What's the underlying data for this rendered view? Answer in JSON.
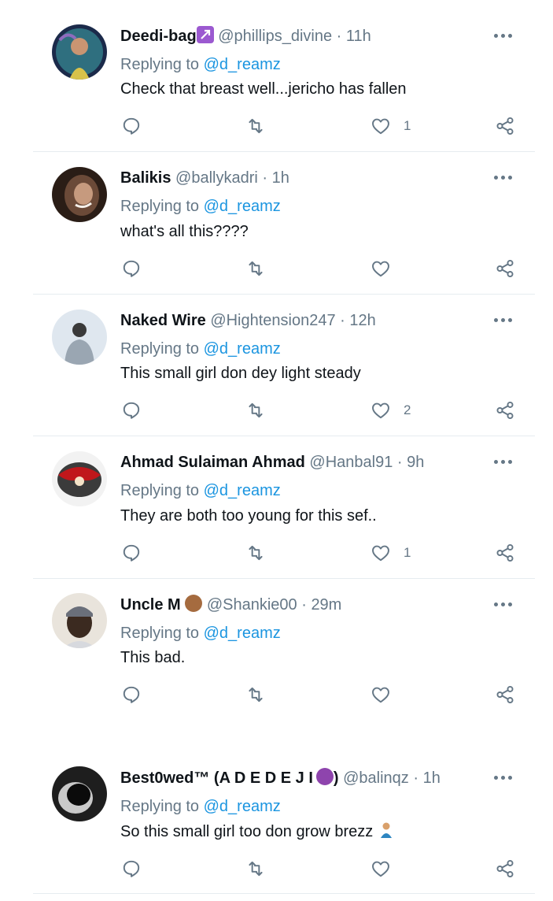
{
  "replies": [
    {
      "name": "Deedi-bag",
      "name_suffix": "",
      "handle": "@phillips_divine",
      "time": "11h",
      "replying_prefix": "Replying to",
      "replying_to": "@d_reamz",
      "text": "Check that breast well...jericho has fallen",
      "likes": "1",
      "avatar_colors": [
        "#1b2a4a",
        "#d8c24a",
        "#8e6bbd"
      ]
    },
    {
      "name": "Balikis",
      "name_suffix": "",
      "handle": "@ballykadri",
      "time": "1h",
      "replying_prefix": "Replying to",
      "replying_to": "@d_reamz",
      "text": "what's all this????",
      "likes": "",
      "avatar_colors": [
        "#2a1d16",
        "#6b4a38",
        "#c69a7e"
      ]
    },
    {
      "name": "Naked Wire",
      "name_suffix": "",
      "handle": "@Hightension247",
      "time": "12h",
      "replying_prefix": "Replying to",
      "replying_to": "@d_reamz",
      "text": "This small girl don dey light steady",
      "likes": "2",
      "avatar_colors": [
        "#dfe7ef",
        "#3a3a3a",
        "#9aa6b2"
      ]
    },
    {
      "name": "Ahmad Sulaiman Ahmad",
      "name_suffix": "",
      "handle": "@Hanbal91",
      "time": "9h",
      "replying_prefix": "Replying to",
      "replying_to": "@d_reamz",
      "text": "They are both too young for this sef..",
      "likes": "1",
      "avatar_colors": [
        "#f2f2f2",
        "#c0171b",
        "#3b3b3b"
      ]
    },
    {
      "name": "Uncle M",
      "name_suffix": "",
      "handle": "@Shankie00",
      "time": "29m",
      "replying_prefix": "Replying to",
      "replying_to": "@d_reamz",
      "text": "This bad.",
      "likes": "",
      "avatar_colors": [
        "#e9e4dc",
        "#3b2a20",
        "#6a6f7a"
      ]
    },
    {
      "name": "Best0wed™ (A D E D E J I",
      "name_suffix": ")",
      "handle": "@balinqz",
      "time": "1h",
      "replying_prefix": "Replying to",
      "replying_to": "@d_reamz",
      "text": "So this small girl too don grow brezz",
      "likes": "",
      "avatar_colors": [
        "#1e1e1e",
        "#c9c9c9",
        "#0b0b0b"
      ]
    }
  ],
  "colors": {
    "text": "#0f1419",
    "secondary": "#657786",
    "link": "#1b95e0",
    "divider": "#e6ecf0"
  },
  "icons": [
    "reply-icon",
    "retweet-icon",
    "like-icon",
    "share-icon",
    "more-icon"
  ]
}
